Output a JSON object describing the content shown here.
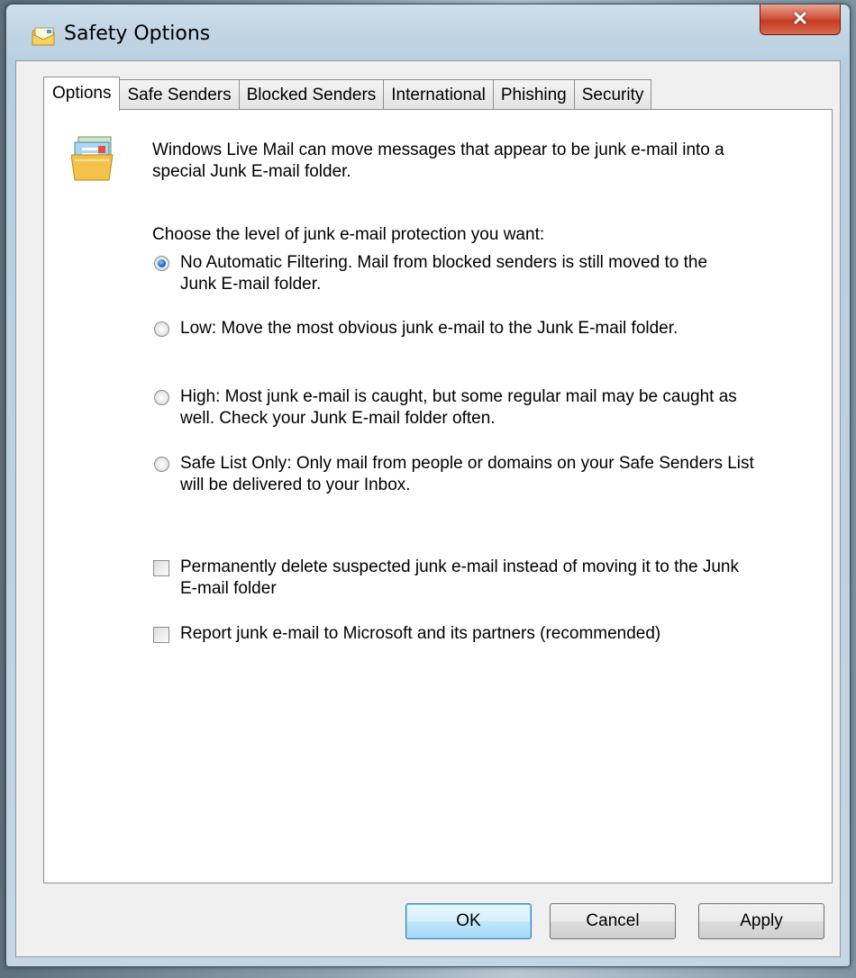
{
  "window": {
    "title": "Safety Options"
  },
  "tabs": [
    {
      "label": "Options",
      "active": true
    },
    {
      "label": "Safe Senders",
      "active": false
    },
    {
      "label": "Blocked Senders",
      "active": false
    },
    {
      "label": "International",
      "active": false
    },
    {
      "label": "Phishing",
      "active": false
    },
    {
      "label": "Security",
      "active": false
    }
  ],
  "options": {
    "intro_line1": "Windows Live Mail can move messages that appear to be junk e-mail into a",
    "intro_line2": "special Junk E-mail folder.",
    "level_prompt": "Choose the level of junk e-mail protection you want:",
    "levels": [
      {
        "line1": "No Automatic Filtering.  Mail from blocked senders is still moved to the",
        "line2": "Junk E-mail folder.",
        "selected": true
      },
      {
        "line1": "Low: Move the most obvious junk e-mail to the Junk E-mail folder.",
        "line2": "",
        "selected": false
      },
      {
        "line1": "High: Most junk e-mail is caught, but some regular mail may be caught as",
        "line2": "well.  Check your Junk E-mail folder often.",
        "selected": false
      },
      {
        "line1": "Safe List Only: Only mail from people or domains on your Safe Senders List",
        "line2": "will be delivered to your Inbox.",
        "selected": false
      }
    ],
    "checks": [
      {
        "line1": "Permanently delete suspected junk e-mail instead of moving it to the Junk",
        "line2": "E-mail folder",
        "checked": false
      },
      {
        "line1": "Report junk e-mail to Microsoft and its partners (recommended)",
        "line2": "",
        "checked": false
      }
    ]
  },
  "buttons": {
    "ok": "OK",
    "cancel": "Cancel",
    "apply": "Apply"
  },
  "icons": {
    "title": "mail-safety-icon",
    "intro": "junk-mail-folder-icon",
    "close": "close-icon"
  },
  "colors": {
    "accent": "#1f6fc8",
    "close": "#c43b22"
  }
}
